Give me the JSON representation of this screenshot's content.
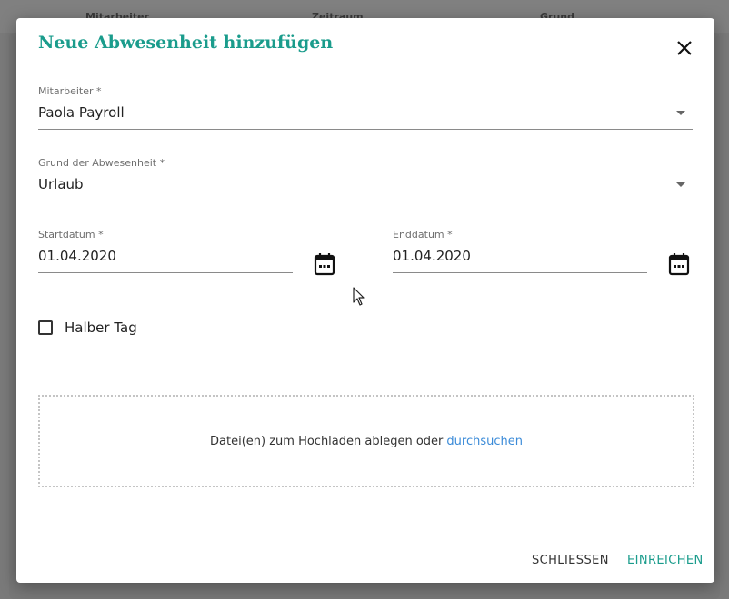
{
  "background": {
    "columns": [
      "Mitarbeiter",
      "Zeitraum",
      "Grund"
    ]
  },
  "dialog": {
    "title": "Neue Abwesenheit hinzufügen",
    "employee": {
      "label": "Mitarbeiter *",
      "value": "Paola Payroll"
    },
    "reason": {
      "label": "Grund der Abwesenheit *",
      "value": "Urlaub"
    },
    "start_date": {
      "label": "Startdatum *",
      "value": "01.04.2020"
    },
    "end_date": {
      "label": "Enddatum *",
      "value": "01.04.2020"
    },
    "half_day": {
      "label": "Halber Tag",
      "checked": false
    },
    "dropzone": {
      "text": "Datei(en) zum Hochladen ablegen oder",
      "link": "durchsuchen"
    },
    "buttons": {
      "close": "SCHLIESSEN",
      "submit": "EINREICHEN"
    }
  },
  "colors": {
    "accent": "#1a9c8c",
    "link": "#3b8bd8"
  }
}
